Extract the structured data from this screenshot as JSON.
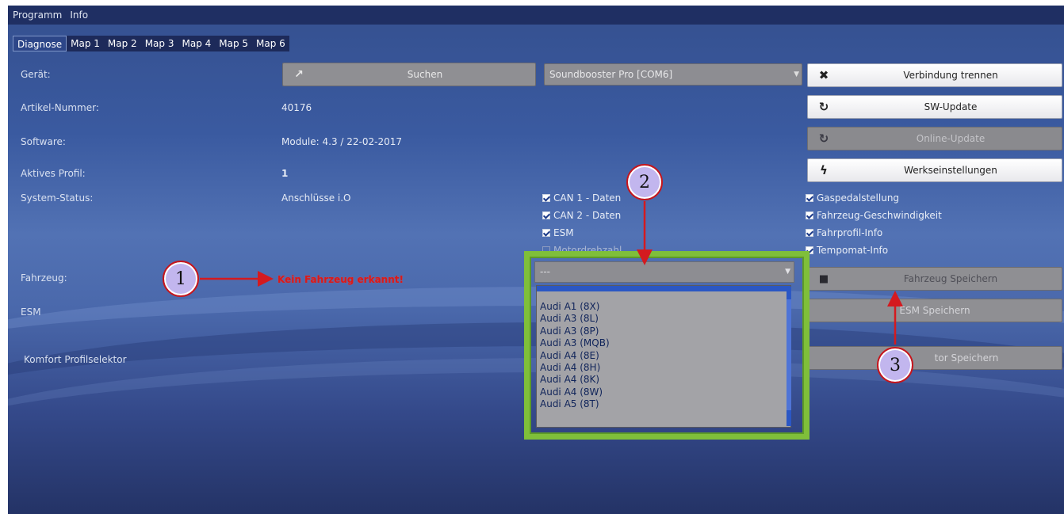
{
  "menu": [
    "Programm",
    "Info"
  ],
  "tabs": [
    "Diagnose",
    "Map 1",
    "Map 2",
    "Map 3",
    "Map 4",
    "Map 5",
    "Map 6"
  ],
  "active_tab": "Diagnose",
  "labels": {
    "geraet": "Gerät:",
    "artikel": "Artikel-Nummer:",
    "software": "Software:",
    "profil": "Aktives Profil:",
    "status": "System-Status:",
    "fahrzeug": "Fahrzeug:",
    "esm": "ESM",
    "komfort": "Komfort Profilselektor"
  },
  "values": {
    "artikel": "40176",
    "software": "Module: 4.3 / 22-02-2017",
    "profil": "1",
    "status": "Anschlüsse i.O",
    "fahrzeug_error": "Kein Fahrzeug erkannt!"
  },
  "buttons": {
    "suchen": "Suchen",
    "device_select": "Soundbooster Pro [COM6]",
    "verbindung": "Verbindung trennen",
    "sw_update": "SW-Update",
    "online_update": "Online-Update",
    "werks": "Werkseinstellungen",
    "fahrzeug_speichern": "Fahrzeug Speichern",
    "esm_speichern": "ESM Speichern",
    "sel_speichern": "Selektor Speichern",
    "sel_speichern_visible": "tor Speichern"
  },
  "checks_mid": [
    {
      "label": "CAN 1 - Daten",
      "checked": true
    },
    {
      "label": "CAN 2 - Daten",
      "checked": true
    },
    {
      "label": "ESM",
      "checked": true
    },
    {
      "label": "Motordrehzahl",
      "checked": false
    }
  ],
  "checks_right": [
    {
      "label": "Gaspedalstellung",
      "checked": true
    },
    {
      "label": "Fahrzeug-Geschwindigkeit",
      "checked": true
    },
    {
      "label": "Fahrprofil-Info",
      "checked": true
    },
    {
      "label": "Tempomat-Info",
      "checked": true
    }
  ],
  "vehicle_dropdown": {
    "selected": "---",
    "items": [
      "Audi A1 (8X)",
      "Audi A3 (8L)",
      "Audi A3 (8P)",
      "Audi A3 (MQB)",
      "Audi A4 (8E)",
      "Audi A4 (8H)",
      "Audi A4 (8K)",
      "Audi A4 (8W)",
      "Audi A5 (8T)"
    ]
  },
  "callouts": [
    "1",
    "2",
    "3"
  ],
  "colors": {
    "highlight": "#7fbf3a",
    "callout_border": "#c6161c",
    "callout_fill": "#c2b6ee",
    "error_text": "#d61b1b"
  },
  "icons": {
    "suchen": "share-icon",
    "verbindung": "close-icon",
    "sw_update": "refresh-icon",
    "online_update": "refresh-icon",
    "werks": "lightning-icon",
    "fahrzeug": "car-icon"
  }
}
